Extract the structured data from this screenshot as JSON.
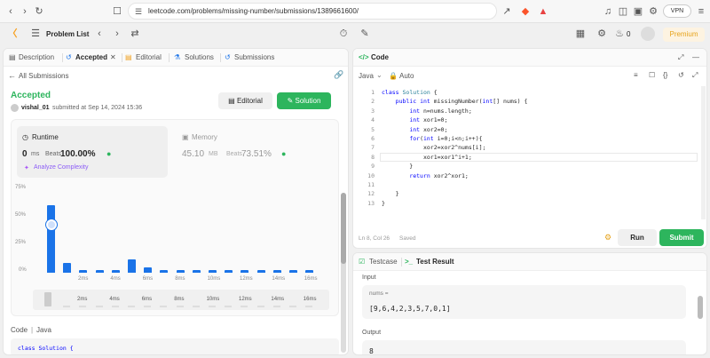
{
  "browser": {
    "url": "leetcode.com/problems/missing-number/submissions/1389661600/",
    "vpn_label": "VPN"
  },
  "toolbar": {
    "problem_list": "Problem List",
    "likes": "0",
    "premium": "Premium"
  },
  "left_tabs": {
    "description": "Description",
    "accepted": "Accepted",
    "editorial": "Editorial",
    "solutions": "Solutions",
    "submissions": "Submissions"
  },
  "submission": {
    "back": "All Submissions",
    "status": "Accepted",
    "user": "vishal_01",
    "submitted_text": "submitted at Sep 14, 2024 15:36",
    "editorial_btn": "Editorial",
    "solution_btn": "Solution"
  },
  "runtime": {
    "label": "Runtime",
    "value": "0",
    "unit": "ms",
    "beats_label": "Beats",
    "beats": "100.00%",
    "analyze": "Analyze Complexity"
  },
  "memory": {
    "label": "Memory",
    "value": "45.10",
    "unit": "MB",
    "beats_label": "Beats",
    "beats": "73.51%"
  },
  "chart_data": {
    "type": "bar",
    "y_ticks": [
      "75%",
      "50%",
      "25%",
      "0%"
    ],
    "ylim": [
      0,
      75
    ],
    "values": [
      61,
      9,
      2,
      2,
      2,
      12,
      5,
      2,
      2,
      2,
      2,
      2,
      2,
      2,
      2,
      2,
      2
    ],
    "x_ticks": [
      "2ms",
      "4ms",
      "6ms",
      "8ms",
      "10ms",
      "12ms",
      "14ms",
      "16ms"
    ],
    "mini_x_ticks": [
      "2ms",
      "4ms",
      "6ms",
      "8ms",
      "10ms",
      "12ms",
      "14ms",
      "16ms"
    ],
    "bar_color": "#1a73e8"
  },
  "code_section": {
    "label": "Code",
    "lang": "Java",
    "preview": "class Solution {"
  },
  "editor": {
    "title": "Code",
    "lang": "Java",
    "auto": "Auto",
    "lines": [
      "class Solution {",
      "    public int missingNumber(int[] nums) {",
      "        int n=nums.length;",
      "        int xor1=0;",
      "        int xor2=0;",
      "        for(int i=0;i<n;i++){",
      "            xor2=xor2^nums[i];",
      "            xor1=xor1^i+1;",
      "        }",
      "        return xor2^xor1;",
      "",
      "    }",
      "}"
    ],
    "status": "Ln 8, Col 26",
    "saved": "Saved",
    "run": "Run",
    "submit": "Submit"
  },
  "test": {
    "testcase_tab": "Testcase",
    "result_tab": "Test Result",
    "input_label": "Input",
    "var_label": "nums =",
    "input_value": "[9,6,4,2,3,5,7,0,1]",
    "output_label": "Output",
    "output_value": "8"
  },
  "colors": {
    "accent_green": "#2db55d",
    "chart_blue": "#1a73e8",
    "premium": "#e6a31c"
  }
}
